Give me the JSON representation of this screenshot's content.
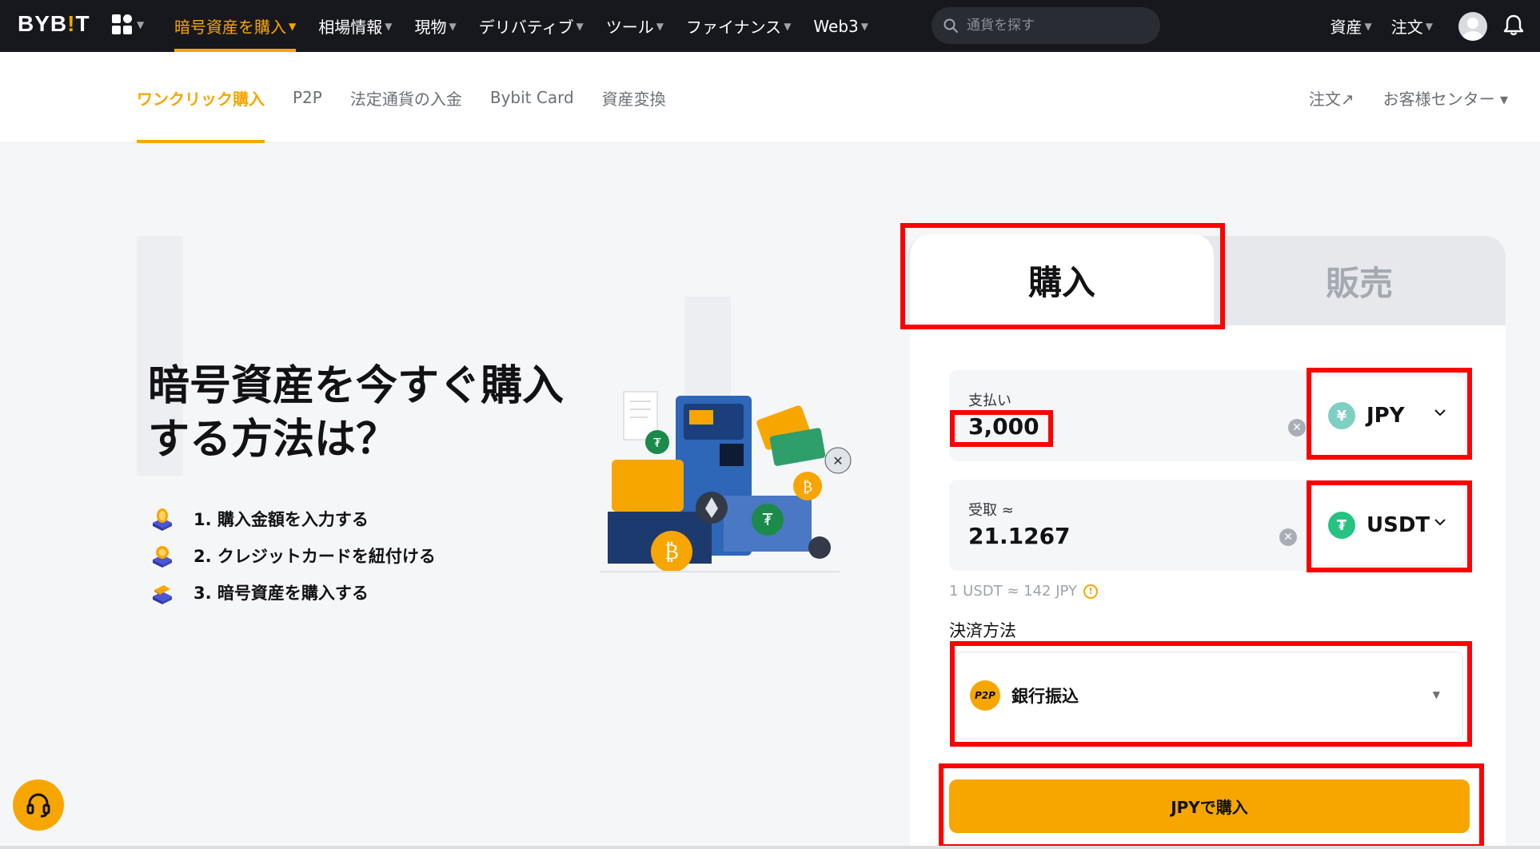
{
  "brand": {
    "logo_text_1": "BYB",
    "logo_text_2": "!",
    "logo_text_3": "T",
    "accent": "#f7a600"
  },
  "topnav": {
    "items": [
      {
        "label": "暗号資産を購入",
        "active": true
      },
      {
        "label": "相場情報"
      },
      {
        "label": "現物"
      },
      {
        "label": "デリバティブ"
      },
      {
        "label": "ツール"
      },
      {
        "label": "ファイナンス"
      },
      {
        "label": "Web3"
      }
    ],
    "search_placeholder": "通貨を探す",
    "right": [
      {
        "label": "資産"
      },
      {
        "label": "注文"
      }
    ]
  },
  "subnav": {
    "items": [
      {
        "label": "ワンクリック購入",
        "active": true
      },
      {
        "label": "P2P"
      },
      {
        "label": "法定通貨の入金"
      },
      {
        "label": "Bybit Card"
      },
      {
        "label": "資産変換"
      }
    ],
    "orders": "注文↗",
    "support": "お客様センター ▾"
  },
  "hero": {
    "title": "暗号資産を今すぐ購入する方法は？",
    "steps": [
      "1. 購入金額を入力する",
      "2. クレジットカードを紐付ける",
      "3. 暗号資産を購入する"
    ]
  },
  "panel": {
    "tab_buy": "購入",
    "tab_sell": "販売",
    "pay": {
      "label": "支払い",
      "value": "3,000",
      "currency": "JPY",
      "currency_icon": "¥"
    },
    "receive": {
      "label": "受取 ≈",
      "value": "21.1267",
      "currency": "USDT",
      "currency_icon": "₮"
    },
    "rate": "1 USDT ≈ 142 JPY",
    "payment_label": "決済方法",
    "payment_method": "銀行振込",
    "payment_badge": "P2P",
    "buy_button": "JPYで購入"
  },
  "colors": {
    "jpy_coin": "#7fcfc3",
    "usdt_coin": "#26c281",
    "highlight": "#ff0000"
  }
}
